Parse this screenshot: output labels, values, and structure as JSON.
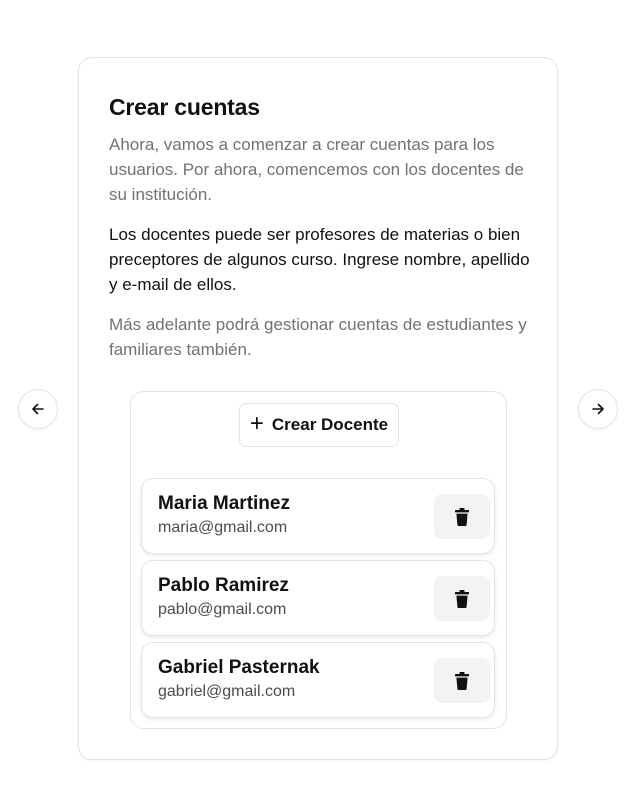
{
  "card": {
    "title": "Crear cuentas",
    "paragraph_1": "Ahora, vamos a comenzar a crear cuentas para los usuarios. Por ahora, comencemos con los docentes de su institución.",
    "paragraph_2": "Los docentes puede ser profesores de materias o bien preceptores de algunos curso. Ingrese nombre, apellido y e-mail de ellos.",
    "paragraph_3": "Más adelante podrá gestionar cuentas de estudiantes y familiares también."
  },
  "create_button": {
    "icon": "plus-icon",
    "label": "Crear Docente"
  },
  "teachers": [
    {
      "name": "Maria Martinez",
      "email": "maria@gmail.com",
      "action_icon": "trash-icon"
    },
    {
      "name": "Pablo Ramirez",
      "email": "pablo@gmail.com",
      "action_icon": "trash-icon"
    },
    {
      "name": "Gabriel Pasternak",
      "email": "gabriel@gmail.com",
      "action_icon": "trash-icon"
    }
  ],
  "navigation": {
    "prev_icon": "arrow-left-icon",
    "next_icon": "arrow-right-icon"
  },
  "colors": {
    "muted_text": "#71717a",
    "border": "#e4e4e7",
    "delete_bg": "#f3f3f4"
  }
}
